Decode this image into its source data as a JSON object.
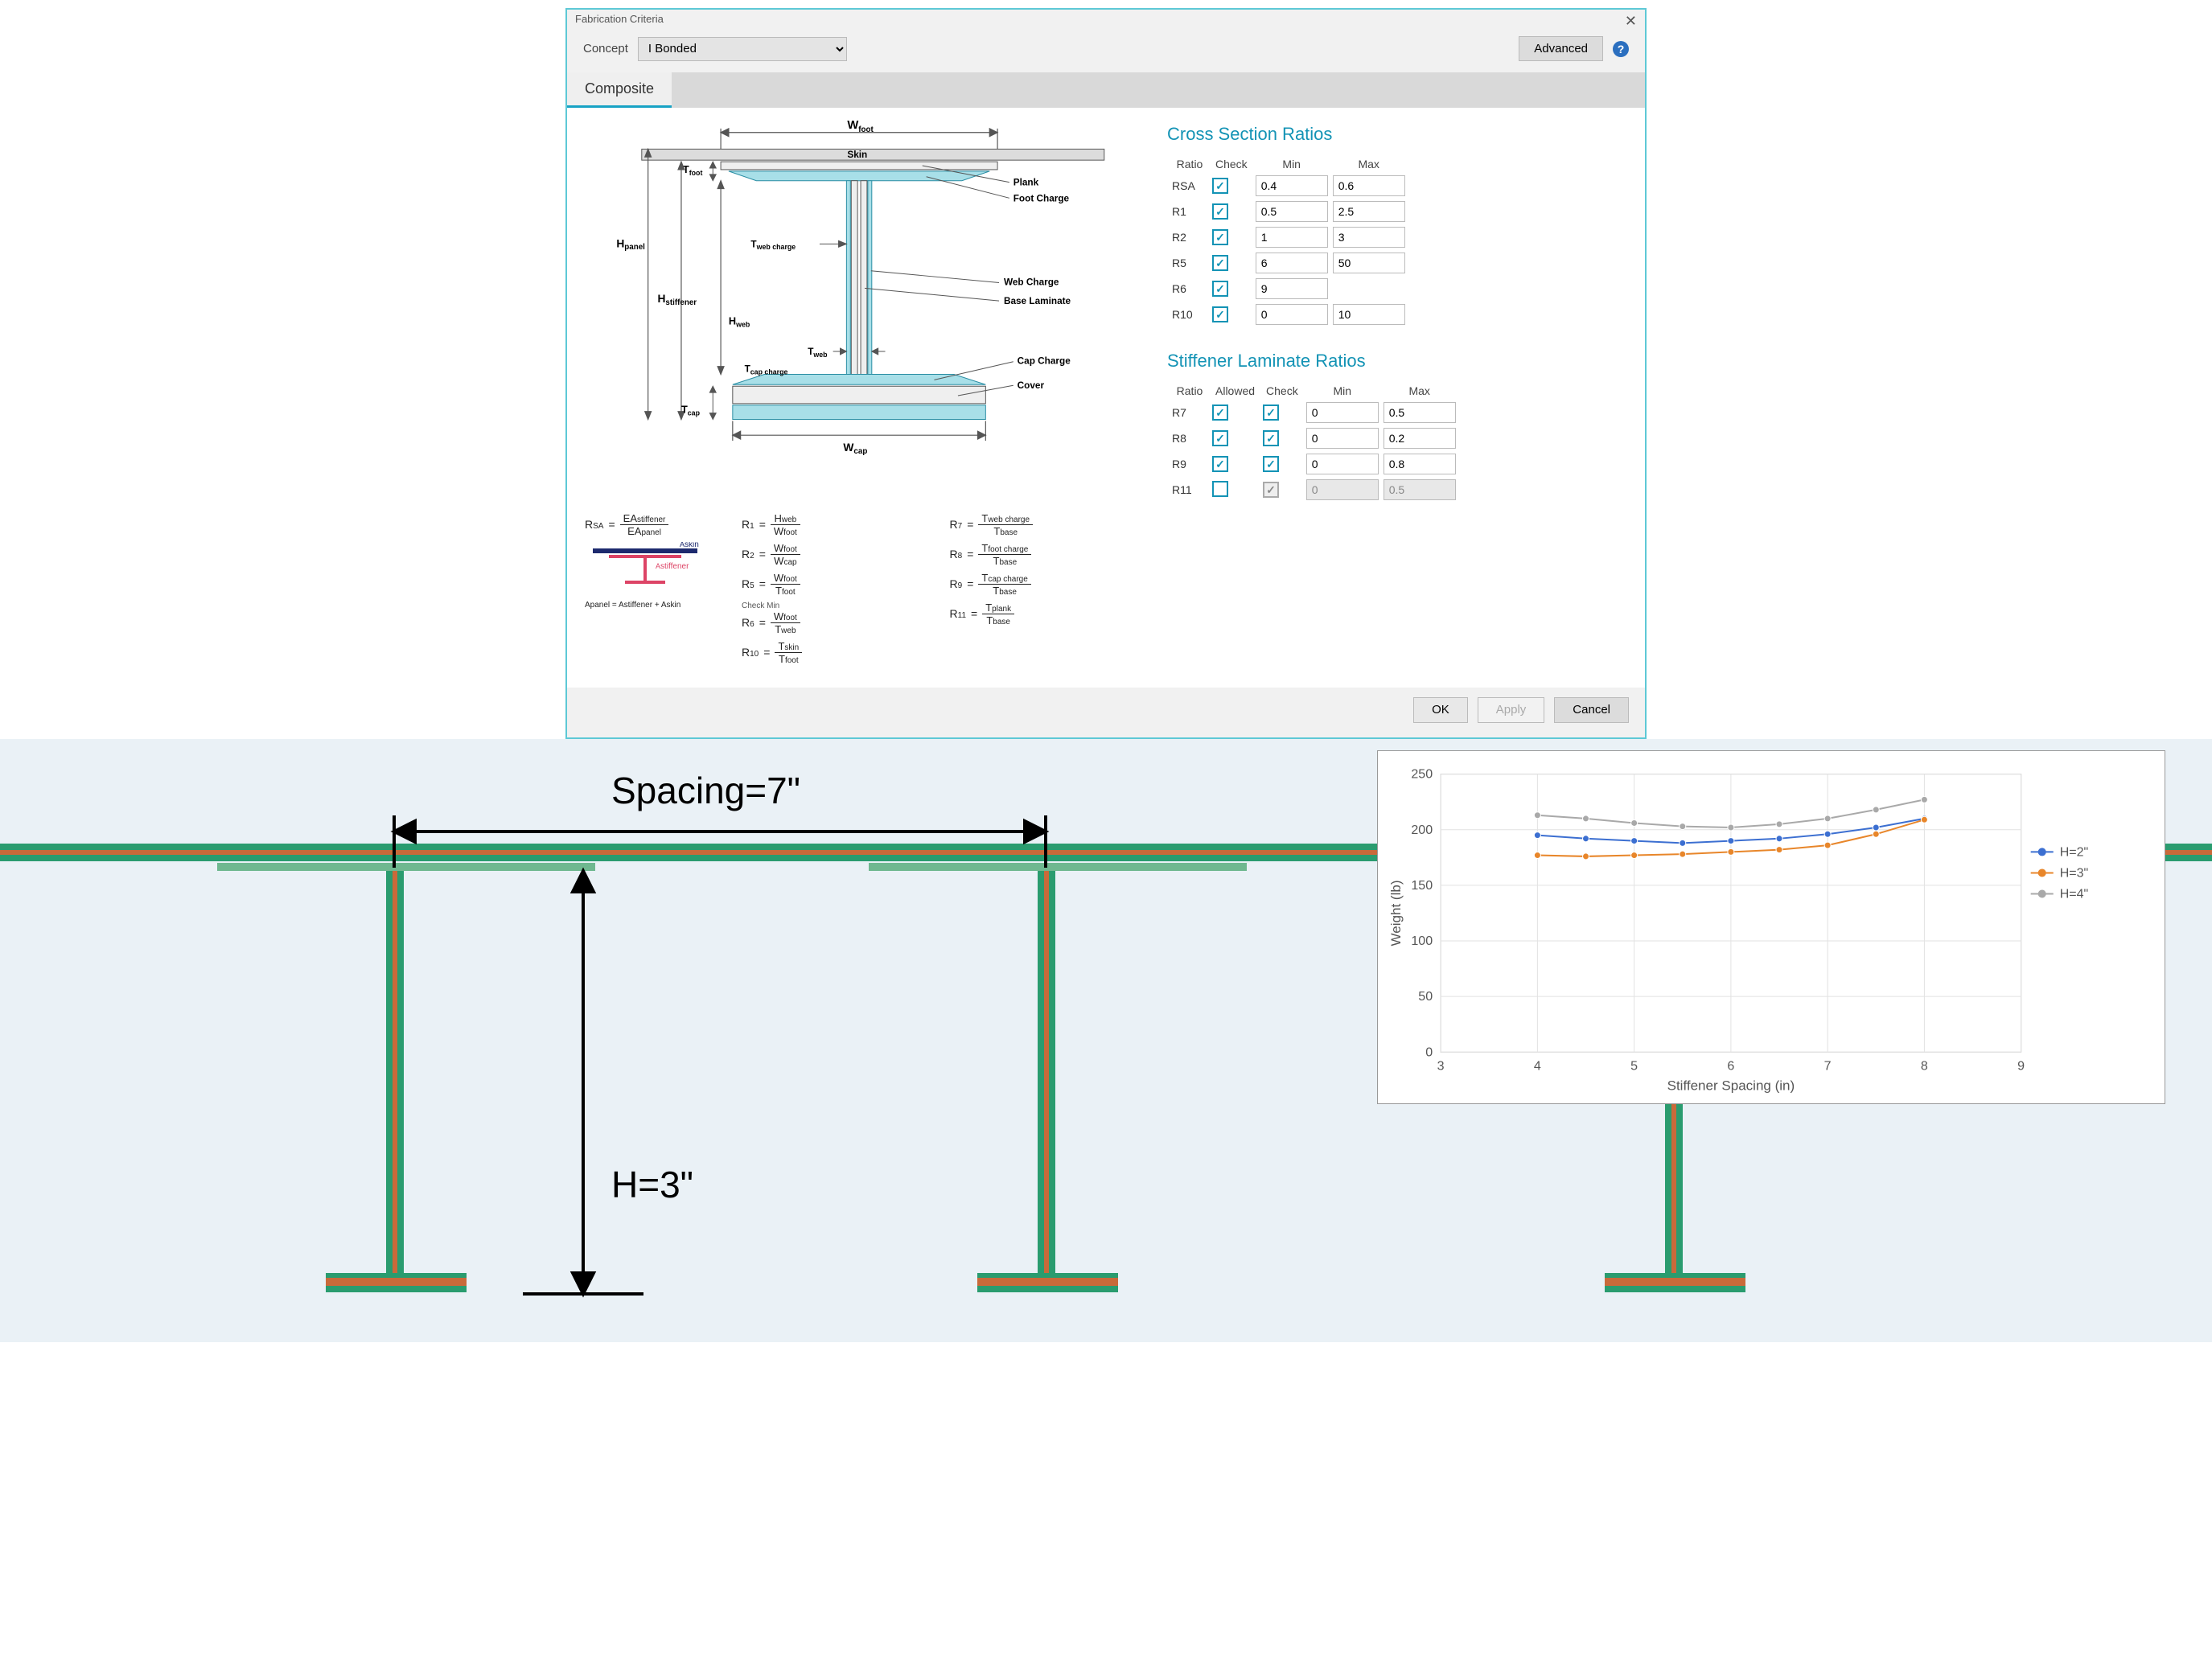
{
  "dialog": {
    "title": "Fabrication Criteria",
    "concept_label": "Concept",
    "concept_value": "I Bonded",
    "advanced_label": "Advanced",
    "tab_label": "Composite",
    "ok_label": "OK",
    "apply_label": "Apply",
    "cancel_label": "Cancel"
  },
  "diagram_labels": {
    "wfoot": "W",
    "wfoot_sub": "foot",
    "skin": "Skin",
    "tfoot": "T",
    "tfoot_sub": "foot",
    "plank": "Plank",
    "foot_charge": "Foot Charge",
    "hpanel": "H",
    "hpanel_sub": "panel",
    "tweb_charge": "T",
    "tweb_charge_sub": "web charge",
    "hstiff": "H",
    "hstiff_sub": "stiffener",
    "hweb": "H",
    "hweb_sub": "web",
    "web_charge": "Web Charge",
    "base_lam": "Base Laminate",
    "tweb": "T",
    "tweb_sub": "web",
    "tcapc": "T",
    "tcapc_sub": "cap charge",
    "cap_charge": "Cap Charge",
    "cover": "Cover",
    "tcap": "T",
    "tcap_sub": "cap",
    "wcap": "W",
    "wcap_sub": "cap"
  },
  "formulas": {
    "rsa": "R",
    "rsa_sub": "SA",
    "ea_stiff": "EA",
    "ea_stiff_sub": "stiffener",
    "ea_panel": "EA",
    "ea_panel_sub": "panel",
    "askin": "A",
    "skin_sub": "skin",
    "astiff": "A",
    "stiff_sub": "stiffener",
    "apanel_eq": "Apanel = Astiffener + Askin",
    "r1": "R",
    "r1s": "1",
    "r2": "R",
    "r2s": "2",
    "r5": "R",
    "r5s": "5",
    "r6": "R",
    "r6s": "6",
    "check_min": "Check Min",
    "r7": "R",
    "r7s": "7",
    "r8": "R",
    "r8s": "8",
    "r9": "R",
    "r9s": "9",
    "r10": "R",
    "r10s": "10",
    "r11": "R",
    "r11s": "11",
    "hweb": "H",
    "hwebs": "web",
    "wfoot": "W",
    "wfoots": "foot",
    "wcap": "W",
    "wcaps": "cap",
    "tfoot": "T",
    "tfoots": "foot",
    "tweb": "T",
    "twebs": "web",
    "tskin": "T",
    "tskins": "skin",
    "twebc": "T",
    "twebcs": "web charge",
    "tfootc": "T",
    "tfootcs": "foot charge",
    "tcapc": "T",
    "tcapcs": "cap charge",
    "tplank": "T",
    "tplanks": "plank",
    "tbase": "T",
    "tbases": "base"
  },
  "cross_section": {
    "title": "Cross Section Ratios",
    "headers": {
      "ratio": "Ratio",
      "check": "Check",
      "min": "Min",
      "max": "Max"
    },
    "rows": [
      {
        "label": "RSA",
        "check": true,
        "min": "0.4",
        "max": "0.6"
      },
      {
        "label": "R1",
        "check": true,
        "min": "0.5",
        "max": "2.5"
      },
      {
        "label": "R2",
        "check": true,
        "min": "1",
        "max": "3"
      },
      {
        "label": "R5",
        "check": true,
        "min": "6",
        "max": "50"
      },
      {
        "label": "R6",
        "check": true,
        "min": "9",
        "max": ""
      },
      {
        "label": "R10",
        "check": true,
        "min": "0",
        "max": "10"
      }
    ]
  },
  "stiffener_ratios": {
    "title": "Stiffener Laminate Ratios",
    "headers": {
      "ratio": "Ratio",
      "allowed": "Allowed",
      "check": "Check",
      "min": "Min",
      "max": "Max"
    },
    "rows": [
      {
        "label": "R7",
        "allowed": true,
        "check": true,
        "min": "0",
        "max": "0.5",
        "disabled": false
      },
      {
        "label": "R8",
        "allowed": true,
        "check": true,
        "min": "0",
        "max": "0.2",
        "disabled": false
      },
      {
        "label": "R9",
        "allowed": true,
        "check": true,
        "min": "0",
        "max": "0.8",
        "disabled": false
      },
      {
        "label": "R11",
        "allowed": false,
        "check": true,
        "min": "0",
        "max": "0.5",
        "disabled": true
      }
    ]
  },
  "lower_labels": {
    "spacing": "Spacing=7\"",
    "height": "H=3\""
  },
  "chart_data": {
    "type": "line",
    "title": "",
    "xlabel": "Stiffener Spacing (in)",
    "ylabel": "Weight (lb)",
    "xlim": [
      3,
      9
    ],
    "ylim": [
      0,
      250
    ],
    "xticks": [
      3,
      4,
      5,
      6,
      7,
      8,
      9
    ],
    "yticks": [
      0,
      50,
      100,
      150,
      200,
      250
    ],
    "x": [
      4.0,
      4.5,
      5.0,
      5.5,
      6.0,
      6.5,
      7.0,
      7.5,
      8.0
    ],
    "series": [
      {
        "name": "H=2\"",
        "color": "#3c6fd1",
        "values": [
          195,
          192,
          190,
          188,
          190,
          192,
          196,
          202,
          210
        ]
      },
      {
        "name": "H=3\"",
        "color": "#e8862a",
        "values": [
          177,
          176,
          177,
          178,
          180,
          182,
          186,
          196,
          209
        ]
      },
      {
        "name": "H=4\"",
        "color": "#a9a9a9",
        "values": [
          213,
          210,
          206,
          203,
          202,
          205,
          210,
          218,
          227
        ]
      }
    ],
    "legend_pos": "right"
  }
}
